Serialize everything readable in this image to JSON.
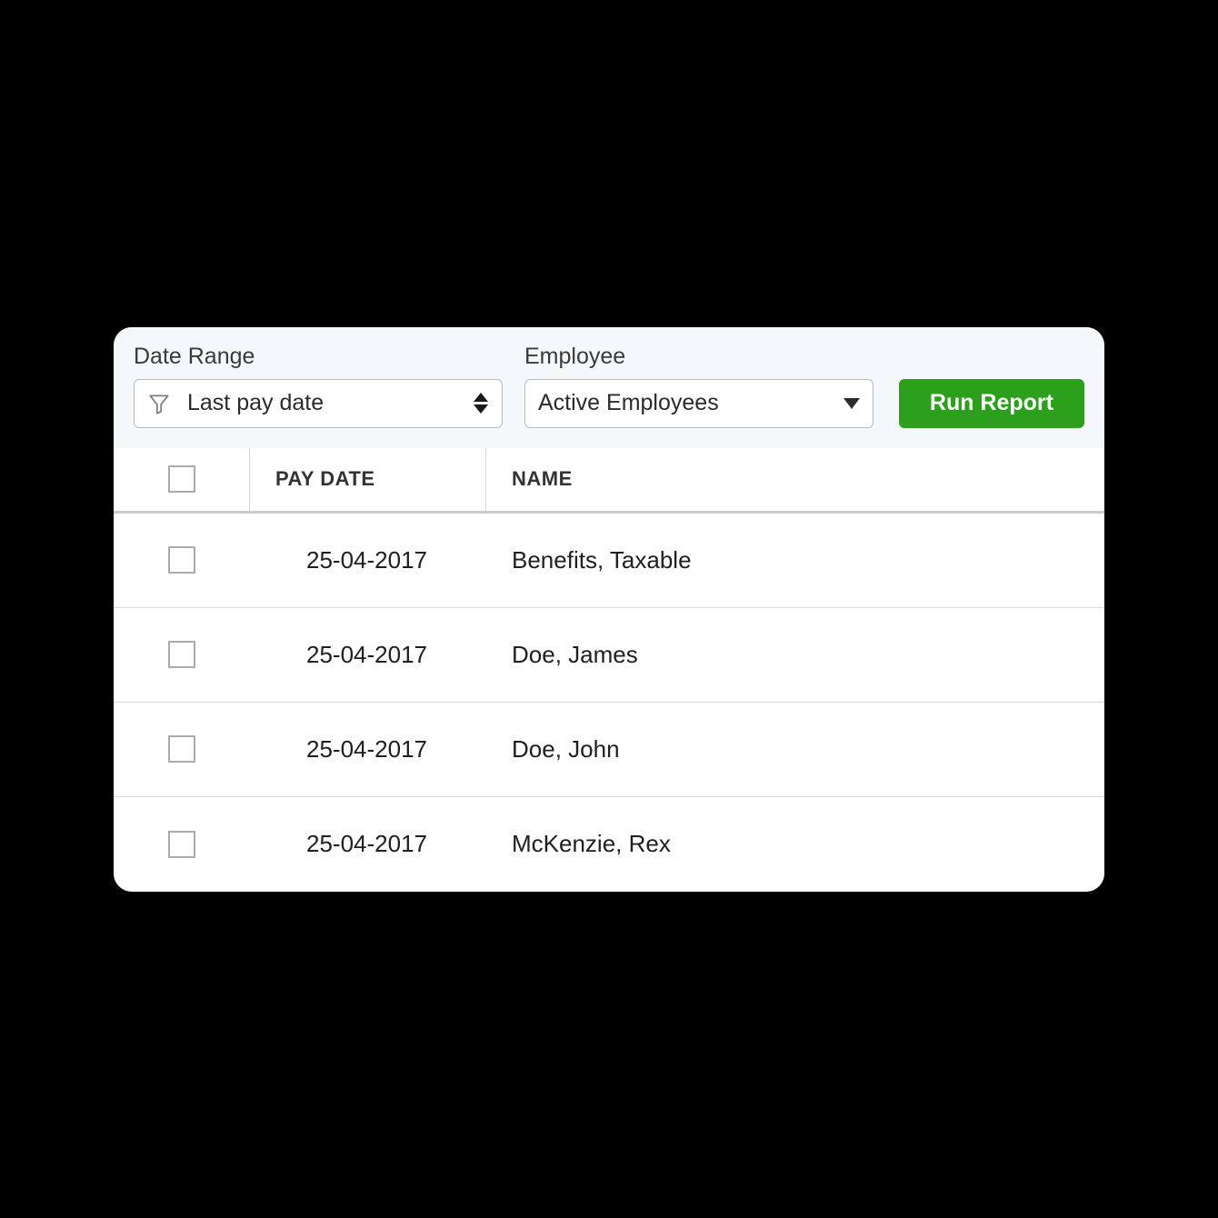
{
  "filters": {
    "date_range": {
      "label": "Date Range",
      "value": "Last pay date"
    },
    "employee": {
      "label": "Employee",
      "value": "Active Employees"
    },
    "run_button": "Run Report"
  },
  "table": {
    "columns": {
      "pay_date": "PAY DATE",
      "name": "NAME"
    },
    "rows": [
      {
        "pay_date": "25-04-2017",
        "name": "Benefits, Taxable"
      },
      {
        "pay_date": "25-04-2017",
        "name": "Doe, James"
      },
      {
        "pay_date": "25-04-2017",
        "name": "Doe, John"
      },
      {
        "pay_date": "25-04-2017",
        "name": "McKenzie, Rex"
      }
    ]
  }
}
